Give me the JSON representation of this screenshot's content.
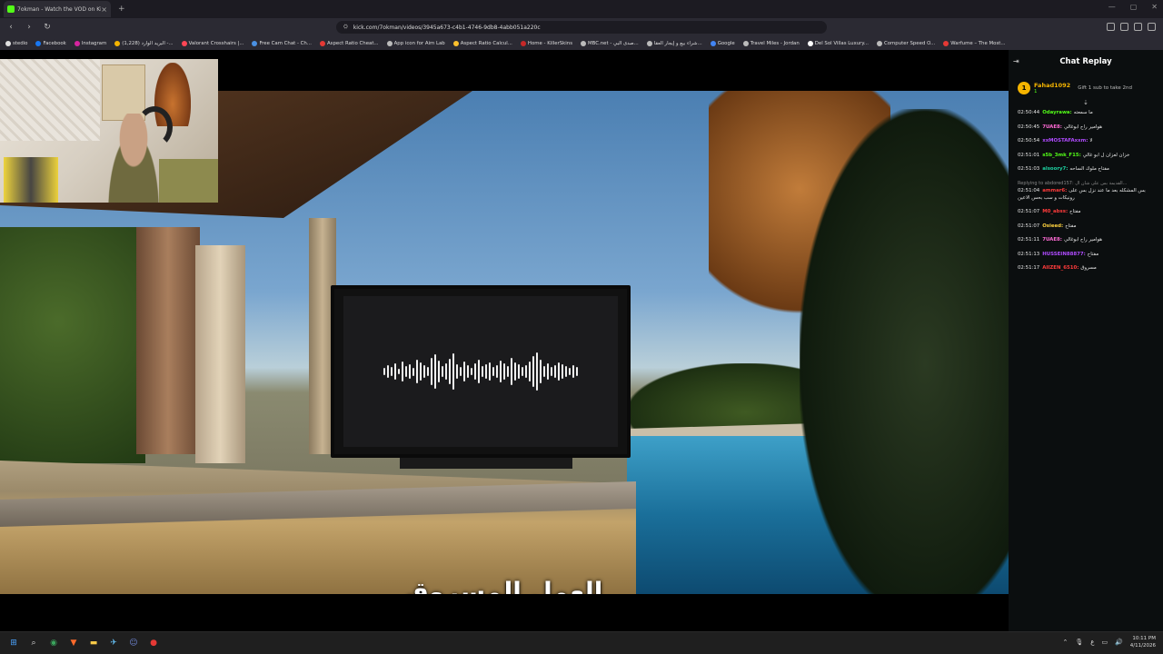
{
  "browser": {
    "tab_title": "7okman - Watch the VOD on Kick",
    "url": "kick.com/7okman/videos/3945a673-c4b1-4746-9db8-4abb051a220c",
    "tab_close": "×",
    "new_tab": "+"
  },
  "bookmarks": [
    {
      "label": "stedio",
      "color": "#e0e0e0"
    },
    {
      "label": "Facebook",
      "color": "#1877f2"
    },
    {
      "label": "Instagram",
      "color": "#d6249f"
    },
    {
      "label": "(1,228) البريد الوارد -...",
      "color": "#f4b400"
    },
    {
      "label": "Valorant Crosshairs |...",
      "color": "#ff4655"
    },
    {
      "label": "Free Cam Chat - Ch...",
      "color": "#4a90e2"
    },
    {
      "label": "Aspect Ratio Cheat...",
      "color": "#e53935"
    },
    {
      "label": "App icon for Aim Lab",
      "color": "#bbbbbb"
    },
    {
      "label": "Aspect Ratio Calcul...",
      "color": "#fbc02d"
    },
    {
      "label": "Home - KillerSkins",
      "color": "#c62828"
    },
    {
      "label": "MBC.net - صدى البي...",
      "color": "#bbbbbb"
    },
    {
      "label": "شراء بيع و إيجار العقا...",
      "color": "#bbbbbb"
    },
    {
      "label": "Google",
      "color": "#4285f4"
    },
    {
      "label": "Travel Miles - Jordan",
      "color": "#bbbbbb"
    },
    {
      "label": "Del Sol Villas Luxury...",
      "color": "#ffffff"
    },
    {
      "label": "Computer Speed O...",
      "color": "#bbbbbb"
    },
    {
      "label": "Warfume – The Most...",
      "color": "#e53935"
    }
  ],
  "video": {
    "subtitle": "العمل المسروق",
    "waveform": [
      8,
      14,
      10,
      18,
      6,
      22,
      12,
      16,
      9,
      26,
      20,
      14,
      10,
      30,
      38,
      24,
      12,
      18,
      28,
      40,
      16,
      10,
      22,
      14,
      8,
      18,
      26,
      12,
      16,
      20,
      10,
      14,
      24,
      18,
      12,
      30,
      20,
      16,
      10,
      14,
      22,
      34,
      42,
      26,
      12,
      18,
      10,
      14,
      20,
      16,
      12,
      8,
      14,
      10
    ]
  },
  "chat": {
    "header": "Chat Replay",
    "pinned": {
      "badge": "1",
      "user": "Fahad1092",
      "count": "1",
      "text": "Gift 1 sub to take 2nd"
    },
    "messages": [
      {
        "ts": "02:50:44",
        "user": "Odayrawa:",
        "color": "#53fc18",
        "text": "ما سمعته"
      },
      {
        "ts": "02:50:45",
        "user": "7UAE8:",
        "color": "#ff6bd5",
        "text": "هوامير راح ابوغالي"
      },
      {
        "ts": "02:50:54",
        "user": "xxMOSTAFAxxm:",
        "color": "#b04bff",
        "text": "لا"
      },
      {
        "ts": "02:51:01",
        "user": "s5b_3mk_F15:",
        "color": "#53fc18",
        "text": "خزان لعزان ل ابو غالي"
      },
      {
        "ts": "02:51:03",
        "user": "alsoory7:",
        "color": "#1dd1a1",
        "text": "مفتاح ملوك الساحه"
      },
      {
        "ts": "02:51:04",
        "user": "ammar6:",
        "color": "#ff3b3b",
        "text": "بس المشكله بعد ما عند نزل بس على رونيكات و سب بحس الاعين",
        "reply": "Replying to abdored157: القديمة بس على شان ال..."
      },
      {
        "ts": "02:51:07",
        "user": "M0_abss:",
        "color": "#ff3b3b",
        "text": "مفتاح"
      },
      {
        "ts": "02:51:07",
        "user": "Osieed:",
        "color": "#ffd23f",
        "text": "مفتاح"
      },
      {
        "ts": "02:51:11",
        "user": "7UAE8:",
        "color": "#ff6bd5",
        "text": "هوامير راح ابوغالي"
      },
      {
        "ts": "02:51:13",
        "user": "HUSSEIN88877:",
        "color": "#b04bff",
        "text": "مفتاح"
      },
      {
        "ts": "02:51:17",
        "user": "AIIZEN_6510:",
        "color": "#ff3b3b",
        "text": "مسروق"
      }
    ]
  },
  "taskbar": {
    "time": "10:11 PM",
    "date": "4/11/2026"
  }
}
